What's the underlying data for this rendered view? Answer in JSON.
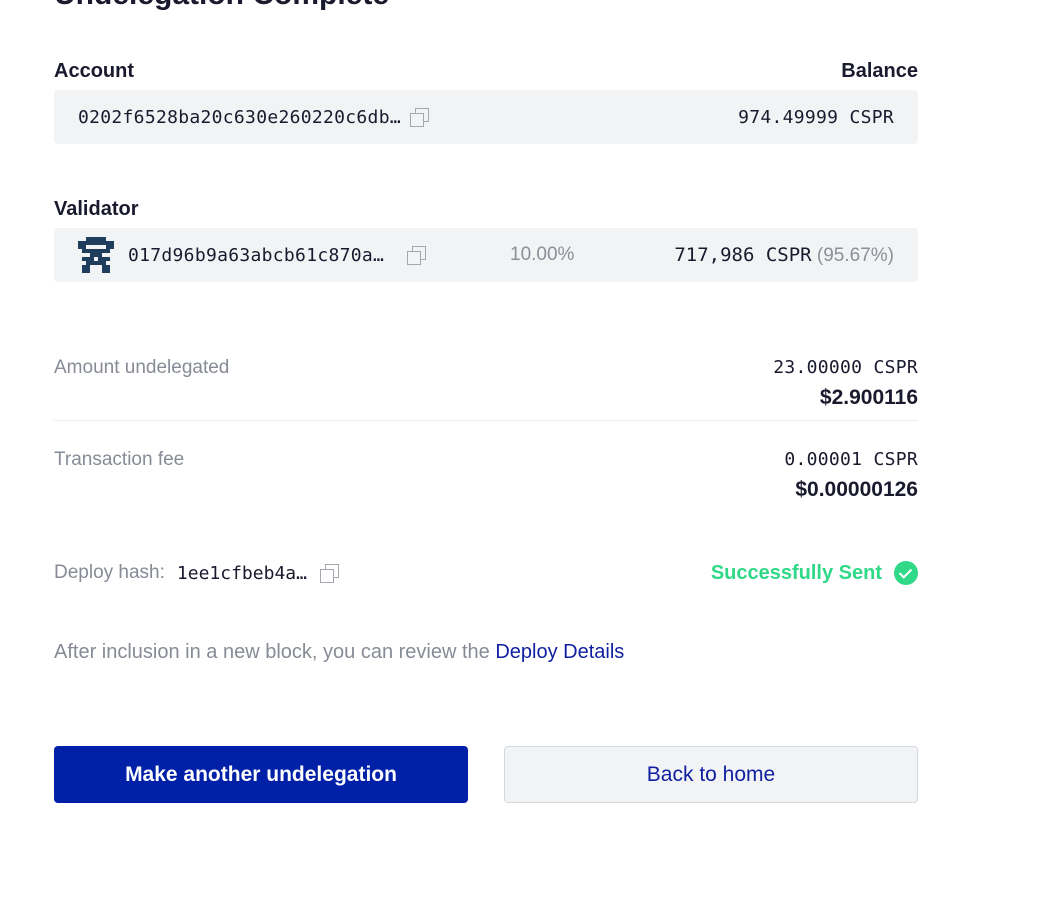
{
  "page": {
    "heading": "Undelegation Complete"
  },
  "account": {
    "label": "Account",
    "balance_label": "Balance",
    "hash": "0202f6528ba20c630e260220c6db…",
    "balance": "974.49999 CSPR"
  },
  "validator": {
    "label": "Validator",
    "hash": "017d96b9a63abcb61c870a…",
    "commission": "10.00%",
    "stake": "717,986 CSPR",
    "stake_pct": "(95.67%)"
  },
  "amount": {
    "label": "Amount undelegated",
    "cspr": "23.00000 CSPR",
    "usd": "$2.900116"
  },
  "fee": {
    "label": "Transaction fee",
    "cspr": "0.00001 CSPR",
    "usd": "$0.00000126"
  },
  "deploy": {
    "label": "Deploy hash:",
    "hash": "1ee1cfbeb4a…",
    "status": "Successfully Sent",
    "status_color": "#2fd987"
  },
  "info": {
    "text": "After inclusion in a new block, you can review the ",
    "link": "Deploy Details"
  },
  "buttons": {
    "primary": "Make another undelegation",
    "secondary": "Back to home"
  },
  "colors": {
    "primary": "#0020a8",
    "link": "#0f1fa0",
    "card_bg": "#f2f3f5"
  }
}
